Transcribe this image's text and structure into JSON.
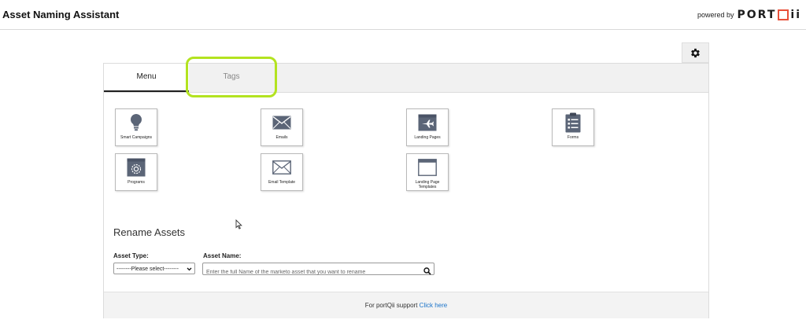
{
  "header": {
    "title": "Asset Naming Assistant",
    "powered_by": "powered by",
    "brand_part1": "PORT",
    "brand_part2": "ii"
  },
  "settings": {
    "icon": "gear-icon"
  },
  "tabs": [
    {
      "label": "Menu",
      "active": true
    },
    {
      "label": "Tags",
      "active": false
    }
  ],
  "tiles": [
    {
      "label": "Smart Campaigns",
      "icon": "lightbulb-icon"
    },
    {
      "label": "Emails",
      "icon": "envelope-icon"
    },
    {
      "label": "Landing Pages",
      "icon": "airplane-icon"
    },
    {
      "label": "Forms",
      "icon": "clipboard-icon"
    },
    {
      "label": "Programs",
      "icon": "program-icon"
    },
    {
      "label": "Email Template",
      "icon": "envelope-outline-icon"
    },
    {
      "label": "Landing Page Templates",
      "icon": "window-icon"
    }
  ],
  "rename": {
    "heading": "Rename Assets",
    "asset_type_label": "Asset Type:",
    "asset_type_value": "--------Please select--------",
    "asset_name_label": "Asset Name:",
    "asset_name_placeholder": "Enter the full Name of the marketo asset that you want to rename"
  },
  "footer": {
    "text": "For portQii support",
    "link": "Click here"
  },
  "colors": {
    "highlight": "#b3e320",
    "link": "#1a73c9",
    "icon": "#5b6577",
    "brand_accent": "#e8503a"
  }
}
